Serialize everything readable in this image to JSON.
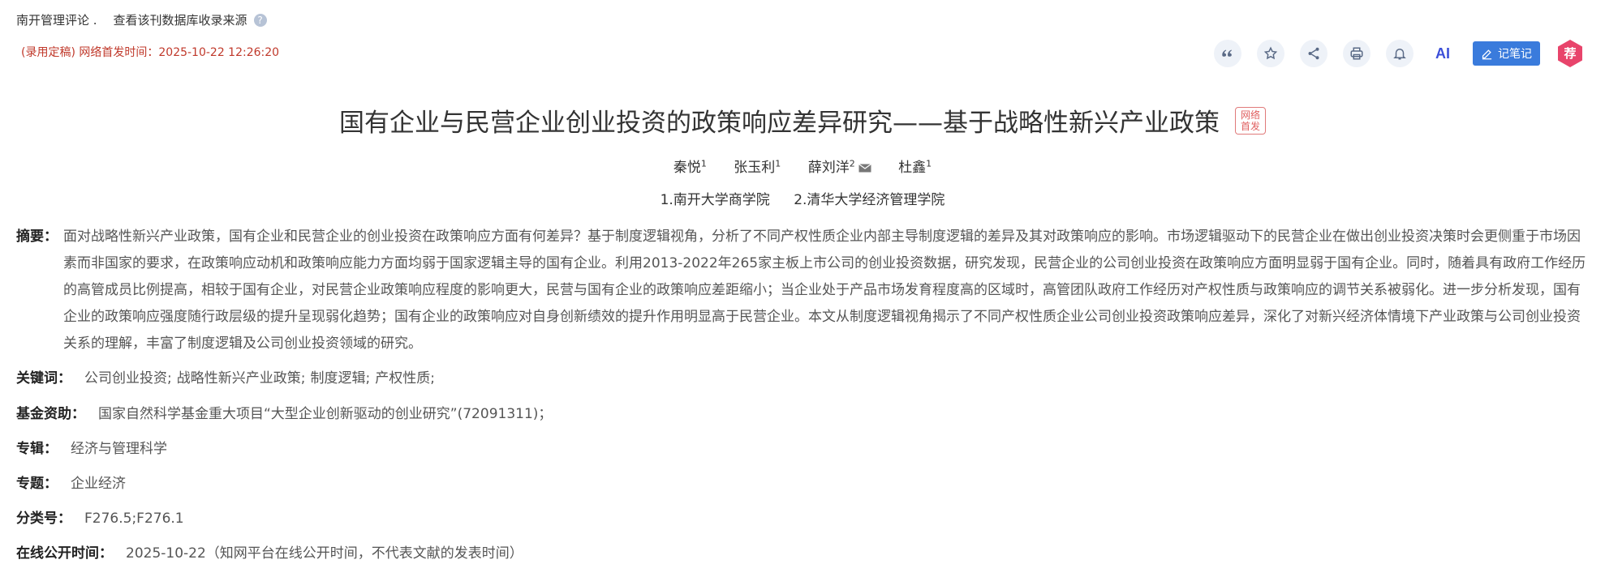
{
  "header": {
    "journal_name": "南开管理评论 .",
    "source_link": "查看该刊数据库收录来源",
    "pub_status": "(录用定稿) 网络首发时间：2025-10-22 12:26:20"
  },
  "toolbar": {
    "items": [
      "quote-icon",
      "star-icon",
      "share-icon",
      "print-icon",
      "bell-icon"
    ],
    "ai_label": "AI",
    "note_label": "记笔记",
    "recommend_label": "荐"
  },
  "article": {
    "title": "国有企业与民营企业创业投资的政策响应差异研究——基于战略性新兴产业政策",
    "net_pub_badge": "网络首发",
    "authors": [
      {
        "name": "秦悦",
        "sup": "1"
      },
      {
        "name": "张玉利",
        "sup": "1"
      },
      {
        "name": "薛刘洋",
        "sup": "2"
      },
      {
        "name": "杜鑫",
        "sup": "1"
      }
    ],
    "affiliations": [
      "1.南开大学商学院",
      "2.清华大学经济管理学院"
    ],
    "abstract_label": "摘要：",
    "abstract": "面对战略性新兴产业政策，国有企业和民营企业的创业投资在政策响应方面有何差异？基于制度逻辑视角，分析了不同产权性质企业内部主导制度逻辑的差异及其对政策响应的影响。市场逻辑驱动下的民营企业在做出创业投资决策时会更侧重于市场因素而非国家的要求，在政策响应动机和政策响应能力方面均弱于国家逻辑主导的国有企业。利用2013-2022年265家主板上市公司的创业投资数据，研究发现，民营企业的公司创业投资在政策响应方面明显弱于国有企业。同时，随着具有政府工作经历的高管成员比例提高，相较于国有企业，对民营企业政策响应程度的影响更大，民营与国有企业的政策响应差距缩小；当企业处于产品市场发育程度高的区域时，高管团队政府工作经历对产权性质与政策响应的调节关系被弱化。进一步分析发现，国有企业的政策响应强度随行政层级的提升呈现弱化趋势；国有企业的政策响应对自身创新绩效的提升作用明显高于民营企业。本文从制度逻辑视角揭示了不同产权性质企业公司创业投资政策响应差异，深化了对新兴经济体情境下产业政策与公司创业投资关系的理解，丰富了制度逻辑及公司创业投资领域的研究。",
    "keywords_label": "关键词：",
    "keywords": [
      "公司创业投资;",
      "战略性新兴产业政策;",
      "制度逻辑;",
      "产权性质;"
    ],
    "fund_label": "基金资助：",
    "fund": "国家自然科学基金重大项目“大型企业创新驱动的创业研究”(72091311)；",
    "series_label": "专辑：",
    "series": "经济与管理科学",
    "topic_label": "专题：",
    "topic": "企业经济",
    "class_label": "分类号：",
    "class": "F276.5;F276.1",
    "online_label": "在线公开时间：",
    "online": "2025-10-22（知网平台在线公开时间，不代表文献的发表时间）"
  },
  "colors": {
    "accent": "#3a7bdc",
    "status_red": "#c0392b",
    "badge_red": "#e06060"
  }
}
